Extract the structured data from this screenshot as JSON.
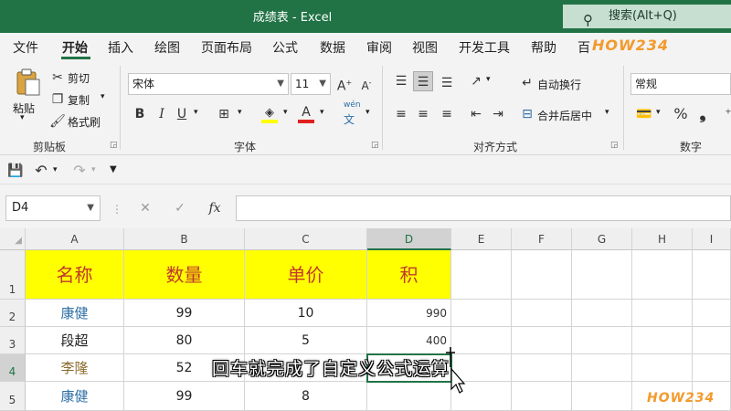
{
  "window": {
    "title": "成绩表 - Excel",
    "search_label": "搜索(Alt+Q)"
  },
  "menu": {
    "tabs": [
      "文件",
      "开始",
      "插入",
      "绘图",
      "页面布局",
      "公式",
      "数据",
      "审阅",
      "视图",
      "开发工具",
      "帮助",
      "百"
    ],
    "active": "开始"
  },
  "watermark": "HOW234",
  "ribbon": {
    "clipboard": {
      "paste": "粘贴",
      "cut": "剪切",
      "copy": "复制",
      "format_painter": "格式刷",
      "label": "剪贴板"
    },
    "font": {
      "family": "宋体",
      "size": "11",
      "bold": "B",
      "italic": "I",
      "underline": "U",
      "phonetic": "wén",
      "label": "字体"
    },
    "alignment": {
      "wrap": "自动换行",
      "merge": "合并后居中",
      "label": "对齐方式"
    },
    "number": {
      "format": "常规",
      "percent": "%",
      "label": "数字"
    }
  },
  "formula_bar": {
    "name_box": "D4",
    "fx": "fx",
    "value": ""
  },
  "grid": {
    "columns": [
      "A",
      "B",
      "C",
      "D",
      "E",
      "F",
      "G",
      "H",
      "I"
    ],
    "selected_column": "D",
    "rows": [
      "1",
      "2",
      "3",
      "4",
      "5"
    ],
    "selected_row": "4",
    "headers": [
      "名称",
      "数量",
      "单价",
      "积"
    ],
    "data": [
      {
        "name": "康健",
        "qty": "99",
        "price": "10",
        "total": "990"
      },
      {
        "name": "段超",
        "qty": "80",
        "price": "5",
        "total": "400"
      },
      {
        "name": "李隆",
        "qty": "52",
        "price": "",
        "total": ""
      },
      {
        "name": "康健",
        "qty": "99",
        "price": "8",
        "total": ""
      }
    ]
  },
  "caption": "回车就完成了自定义公式运算"
}
